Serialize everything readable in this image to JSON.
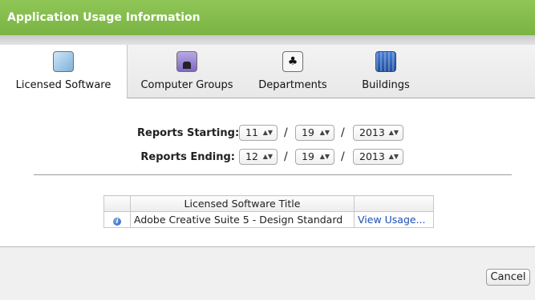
{
  "window": {
    "title": "Application Usage Information"
  },
  "tabs": [
    {
      "label": "Licensed Software",
      "icon": "licensed-software-icon",
      "selected": true
    },
    {
      "label": "Computer Groups",
      "icon": "computer-groups-icon",
      "selected": false
    },
    {
      "label": "Departments",
      "icon": "departments-icon",
      "selected": false
    },
    {
      "label": "Buildings",
      "icon": "buildings-icon",
      "selected": false
    }
  ],
  "reports": {
    "start": {
      "label": "Reports Starting:",
      "month": "11",
      "day": "19",
      "year": "2013"
    },
    "end": {
      "label": "Reports Ending:",
      "month": "12",
      "day": "19",
      "year": "2013"
    },
    "separator": "/"
  },
  "table": {
    "header": "Licensed Software Title",
    "rows": [
      {
        "title": "Adobe Creative Suite 5 - Design Standard",
        "action": "View Usage..."
      }
    ]
  },
  "footer": {
    "cancel_label": "Cancel"
  },
  "colors": {
    "title_bar": "#7ab443",
    "link": "#1a4fb3"
  }
}
